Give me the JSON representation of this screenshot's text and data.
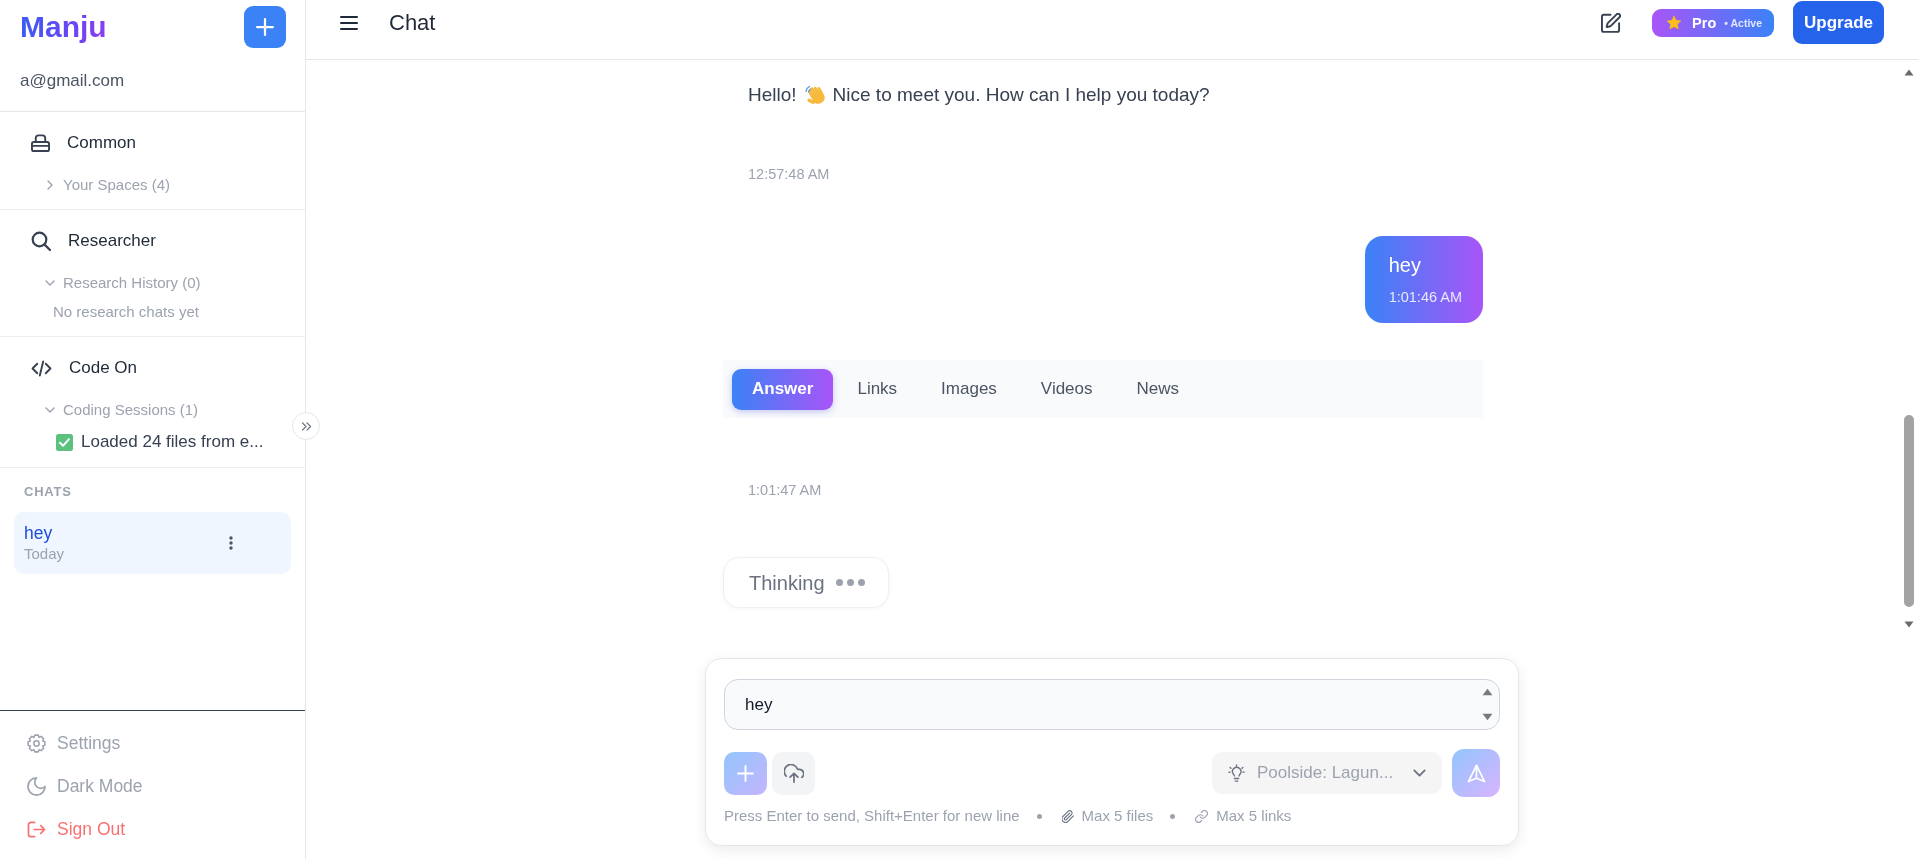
{
  "sidebar": {
    "logo": "Manju",
    "email": "a@gmail.com",
    "sections": [
      {
        "kind": "spaces",
        "title": "Common",
        "group": {
          "label": "Your Spaces (4)",
          "expanded": false
        }
      },
      {
        "kind": "research",
        "title": "Researcher",
        "group": {
          "label": "Research History (0)",
          "expanded": true,
          "empty_text": "No research chats yet"
        }
      },
      {
        "kind": "code",
        "title": "Code On",
        "group": {
          "label": "Coding Sessions (1)",
          "expanded": true,
          "items": [
            {
              "title": "Loaded 24 files from e..."
            }
          ]
        }
      }
    ],
    "chats_heading": "CHATS",
    "chats": [
      {
        "title": "hey",
        "date": "Today",
        "selected": true
      }
    ],
    "footer": [
      {
        "kind": "settings",
        "label": "Settings"
      },
      {
        "kind": "theme",
        "label": "Dark Mode"
      },
      {
        "kind": "signout",
        "label": "Sign Out"
      }
    ]
  },
  "header": {
    "title": "Chat",
    "plan": {
      "name": "Pro",
      "status": "• Active"
    },
    "upgrade": "Upgrade"
  },
  "messages": [
    {
      "kind": "assistant",
      "greeting": "Hello!",
      "text": "Nice to meet you. How can I help you today?",
      "time": "12:57:48 AM"
    },
    {
      "kind": "user",
      "text": "hey",
      "time": "1:01:46 AM"
    },
    {
      "kind": "assistant",
      "tabs": [
        {
          "label": "Answer",
          "selected": true
        },
        {
          "label": "Links",
          "selected": false
        },
        {
          "label": "Images",
          "selected": false
        },
        {
          "label": "Videos",
          "selected": false
        },
        {
          "label": "News",
          "selected": false
        }
      ],
      "time": "1:01:47 AM"
    }
  ],
  "thinking": {
    "text": "Thinking"
  },
  "composer": {
    "value": "hey",
    "model": "Poolside: Lagun...",
    "hints": [
      {
        "kind": "keys",
        "text": "Press Enter to send, Shift+Enter for new line"
      },
      {
        "kind": "files",
        "text": "Max 5 files"
      },
      {
        "kind": "links",
        "text": "Max 5 links"
      }
    ]
  }
}
